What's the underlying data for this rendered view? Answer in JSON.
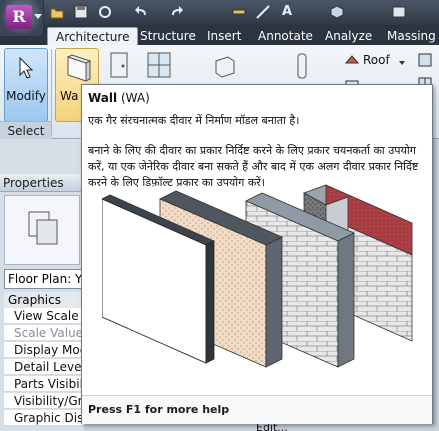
{
  "ribbon": {
    "tabs": [
      "Architecture",
      "Structure",
      "Insert",
      "Annotate",
      "Analyze",
      "Massing &"
    ],
    "active_tab": "Architecture",
    "modify_label": "Modify",
    "select_label": "Select",
    "wall_label": "Wa",
    "roof_label": "Roof"
  },
  "properties": {
    "title": "Properties",
    "type_selector": "Floor Plan: Yp",
    "group": "Graphics",
    "rows": [
      {
        "label": "View Scale",
        "dim": false
      },
      {
        "label": "Scale Value",
        "dim": true
      },
      {
        "label": "Display Moc",
        "dim": false
      },
      {
        "label": "Detail Level",
        "dim": false
      },
      {
        "label": "Parts Visibilit",
        "dim": false
      },
      {
        "label": "Visibility/Gra",
        "dim": false
      },
      {
        "label": "Graphic Display Options",
        "dim": false
      }
    ],
    "edit_label": "Edit..."
  },
  "tooltip": {
    "title": "Wall",
    "shortcut": "(WA)",
    "description": "एक गैर संरचनात्मक दीवार में निर्माण मॉडल बनाता है।",
    "body": "बनाने के लिए की दीवार का प्रकार निर्दिष्ट करने के लिए प्रकार चयनकर्ता का उपयोग करें, या एक जेनेरिक दीवार बना सकते हैं और बाद में एक अलग दीवार प्रकार निर्दिष्ट करने के लिए डिफ़ॉल्ट प्रकार का उपयोग करें।",
    "footer": "Press F1 for more help"
  },
  "colors": {
    "accent": "#9cc8ef",
    "tab_bar": "#2b3440",
    "brick": "#b5444a",
    "plaster": "#f3dcc6"
  }
}
